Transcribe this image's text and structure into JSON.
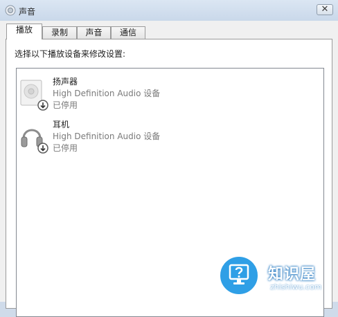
{
  "window": {
    "title": "声音",
    "close_label": "✕"
  },
  "tabs": [
    {
      "label": "播放",
      "active": true
    },
    {
      "label": "录制",
      "active": false
    },
    {
      "label": "声音",
      "active": false
    },
    {
      "label": "通信",
      "active": false
    }
  ],
  "playback": {
    "prompt": "选择以下播放设备来修改设置:",
    "devices": [
      {
        "name": "扬声器",
        "description": "High Definition Audio 设备",
        "status": "已停用",
        "icon": "speaker-icon"
      },
      {
        "name": "耳机",
        "description": "High Definition Audio 设备",
        "status": "已停用",
        "icon": "headphones-icon"
      }
    ]
  },
  "watermark": {
    "title": "知识屋",
    "url": "zhishiwu.com"
  },
  "colors": {
    "accent": "#2f9fe6",
    "disabled_text": "#7a7a7a",
    "titlebar": "#cfdbea"
  }
}
